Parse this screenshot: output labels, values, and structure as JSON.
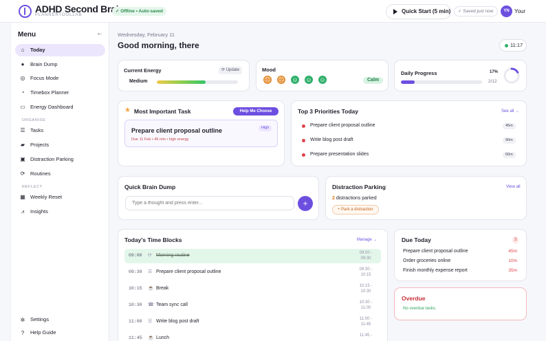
{
  "header": {
    "app_title": "ADHD Second Brain",
    "app_subtitle": "PLANNERTOOLLAB",
    "offline_status": "Offline • Auto-saved",
    "quick_start_label": "Quick Start (5 min)",
    "saved_status": "Saved just now",
    "user_initials": "YN",
    "user_name": "Your"
  },
  "sidebar": {
    "title": "Menu",
    "collapse_icon": "←",
    "items": [
      {
        "label": "Today",
        "icon": "home-icon"
      },
      {
        "label": "Brain Dump",
        "icon": "lightbulb-icon"
      },
      {
        "label": "Focus Mode",
        "icon": "target-icon"
      },
      {
        "label": "Timebox Planner",
        "icon": "clock-icon"
      },
      {
        "label": "Energy Dashboard",
        "icon": "battery-icon"
      }
    ],
    "section_organise": "ORGANISE",
    "organise_items": [
      {
        "label": "Tasks",
        "icon": "list-icon"
      },
      {
        "label": "Projects",
        "icon": "folder-icon"
      },
      {
        "label": "Distraction Parking",
        "icon": "parking-icon"
      },
      {
        "label": "Routines",
        "icon": "repeat-icon"
      }
    ],
    "section_reflect": "REFLECT",
    "reflect_items": [
      {
        "label": "Weekly Reset",
        "icon": "calendar-icon"
      },
      {
        "label": "Insights",
        "icon": "chart-icon"
      }
    ],
    "bottom_items": [
      {
        "label": "Settings",
        "icon": "gear-icon"
      },
      {
        "label": "Help Guide",
        "icon": "help-icon"
      }
    ]
  },
  "main": {
    "date": "Wednesday, February 11",
    "greeting": "Good morning, there",
    "clock": "11:17"
  },
  "energy": {
    "title": "Current Energy",
    "update_label": "Update",
    "level_label": "Medium",
    "level_fraction": 0.6
  },
  "mood": {
    "title": "Mood",
    "faces": [
      "☹",
      "☹",
      "☺",
      "☺",
      "☺"
    ],
    "face_colors": [
      "#e38a2b",
      "#e38a2b",
      "#2fb06b",
      "#2fb06b",
      "#2fb06b"
    ],
    "selected": "Calm"
  },
  "progress": {
    "title": "Daily Progress",
    "percent_label": "17%",
    "count_label": "2/12",
    "fraction": 0.17
  },
  "mit": {
    "title": "Most Important Task",
    "help_label": "Help Me Choose",
    "task": "Prepare client proposal outline",
    "meta": "Due 11 Feb • 45 min • high energy",
    "priority": "High"
  },
  "priorities": {
    "title": "Top 3 Priorities Today",
    "see_all": "See all →",
    "items": [
      {
        "label": "Prepare client proposal outline",
        "duration": "45m"
      },
      {
        "label": "Write blog post draft",
        "duration": "90m"
      },
      {
        "label": "Prepare presentation slides",
        "duration": "60m"
      }
    ]
  },
  "brain_dump": {
    "title": "Quick Brain Dump",
    "placeholder": "Type a thought and press enter...",
    "add_label": "+"
  },
  "distraction": {
    "title": "Distraction Parking",
    "view_all": "View all",
    "count": "2",
    "count_suffix": "distractions parked",
    "park_label": "+ Park a distraction"
  },
  "time_blocks": {
    "title": "Today's Time Blocks",
    "manage_label": "Manage →",
    "rows": [
      {
        "time": "09:00",
        "icon": "⟳",
        "label": "Morning routine",
        "range_start": "09:00 -",
        "range_end": "09:30"
      },
      {
        "time": "09:30",
        "icon": "☰",
        "label": "Prepare client proposal outline",
        "range_start": "09:30 -",
        "range_end": "10:15"
      },
      {
        "time": "10:15",
        "icon": "☕",
        "label": "Break",
        "range_start": "10:15 -",
        "range_end": "10:30"
      },
      {
        "time": "10:30",
        "icon": "☎",
        "label": "Team sync call",
        "range_start": "10:30 -",
        "range_end": "11:00"
      },
      {
        "time": "11:00",
        "icon": "☰",
        "label": "Write blog post draft",
        "range_start": "11:00 -",
        "range_end": "11:45"
      },
      {
        "time": "11:45",
        "icon": "☕",
        "label": "Lunch",
        "range_start": "11:45 -",
        "range_end": ""
      }
    ]
  },
  "due_today": {
    "title": "Due Today",
    "count": "3",
    "items": [
      {
        "label": "Prepare client proposal outline",
        "time": "45m"
      },
      {
        "label": "Order groceries online",
        "time": "10m"
      },
      {
        "label": "Finish monthly expense report",
        "time": "35m"
      }
    ]
  },
  "overdue": {
    "title": "Overdue",
    "empty_text": "No overdue tasks."
  }
}
